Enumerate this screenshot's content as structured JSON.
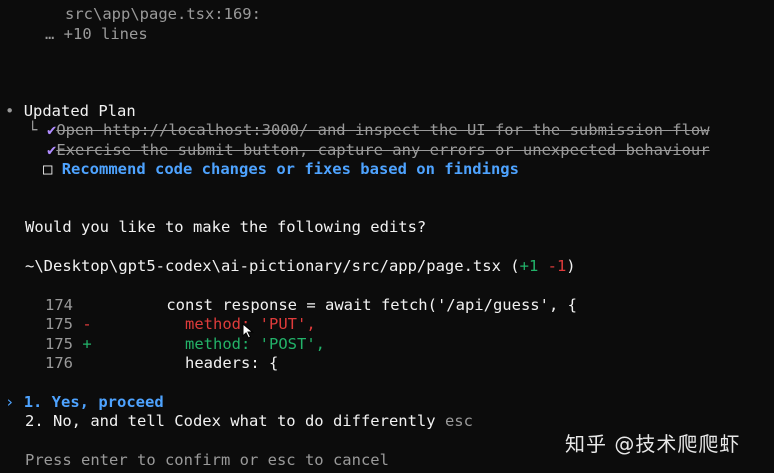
{
  "top": {
    "file_ref": "src\\app\\page.tsx:169:",
    "more_lines": "… +10 lines"
  },
  "plan": {
    "bullet": "•",
    "title": "Updated Plan",
    "connector": "└",
    "items": [
      {
        "status": "done",
        "text": "Open http://localhost:3000/ and inspect the UI for the submission flow"
      },
      {
        "status": "done",
        "text": "Exercise the submit button, capture any errors or unexpected behaviour"
      },
      {
        "status": "pending",
        "text": "Recommend code changes or fixes based on findings"
      }
    ],
    "checkmark": "✔",
    "checkbox": "□"
  },
  "prompt": {
    "question": "Would you like to make the following edits?",
    "path": "~\\Desktop\\gpt5-codex\\ai-pictionary/src/app/page.tsx",
    "added": "+1",
    "removed": "-1",
    "paren_open": "(",
    "paren_close": ")"
  },
  "diff": [
    {
      "num": "174",
      "sign": " ",
      "code": "    const response = await fetch('/api/guess', {",
      "type": "context"
    },
    {
      "num": "175",
      "sign": "-",
      "code": "      method: 'PUT',",
      "type": "removed"
    },
    {
      "num": "175",
      "sign": "+",
      "code": "      method: 'POST',",
      "type": "added"
    },
    {
      "num": "176",
      "sign": " ",
      "code": "      headers: {",
      "type": "context"
    }
  ],
  "options": {
    "selected_marker": "›",
    "items": [
      {
        "label": "1. Yes, proceed",
        "hint": ""
      },
      {
        "label": "2. No, and tell Codex what to do differently",
        "hint": "esc"
      }
    ]
  },
  "footer": {
    "help": "Press enter to confirm or esc to cancel"
  },
  "watermark": {
    "text": "知乎 @技术爬爬虾"
  },
  "colors": {
    "background": "#0c0c0c",
    "accent_blue": "#4ea3ff",
    "added_green": "#22b36a",
    "removed_red": "#e03b3b",
    "check_purple": "#b08cff"
  }
}
